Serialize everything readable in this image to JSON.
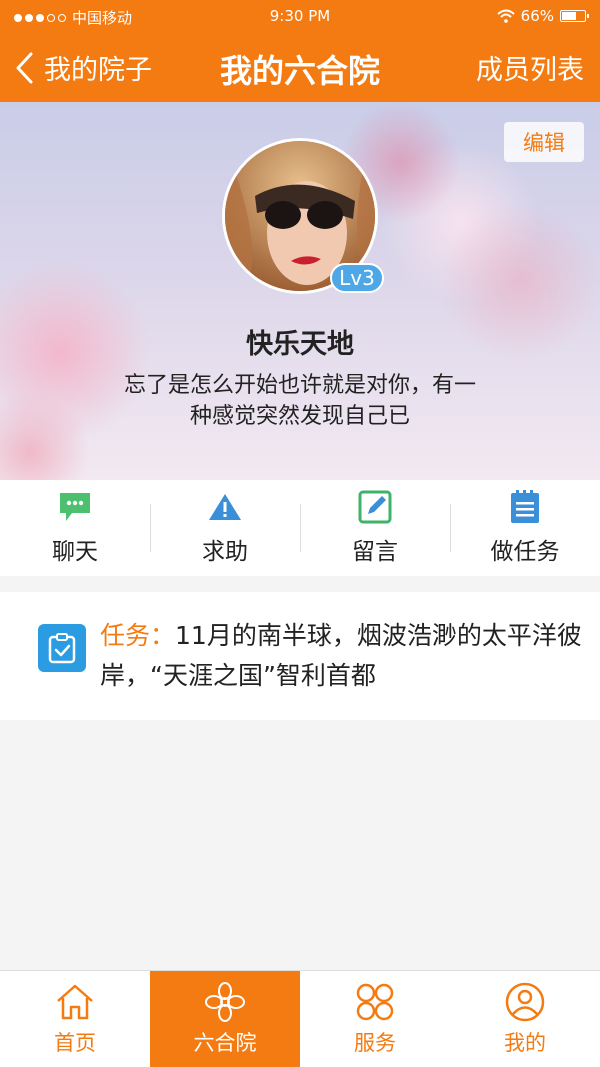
{
  "status_bar": {
    "carrier": "中国移动",
    "time": "9:30 PM",
    "battery": "66%"
  },
  "nav": {
    "back_label": "我的院子",
    "title": "我的六合院",
    "members_label": "成员列表"
  },
  "profile": {
    "edit_label": "编辑",
    "level": "Lv3",
    "name": "快乐天地",
    "bio_line1": "忘了是怎么开始也许就是对你，有一",
    "bio_line2": "种感觉突然发现自己已"
  },
  "actions": [
    {
      "label": "聊天",
      "icon": "chat-icon"
    },
    {
      "label": "求助",
      "icon": "warning-icon"
    },
    {
      "label": "留言",
      "icon": "edit-note-icon"
    },
    {
      "label": "做任务",
      "icon": "task-list-icon"
    }
  ],
  "task": {
    "prefix": "任务：",
    "text": "11月的南半球，烟波浩渺的太平洋彼岸，“天涯之国”智利首都"
  },
  "tabs": [
    {
      "label": "首页",
      "icon": "home-icon",
      "active": false
    },
    {
      "label": "六合院",
      "icon": "flower-icon",
      "active": true
    },
    {
      "label": "服务",
      "icon": "grid-icon",
      "active": false
    },
    {
      "label": "我的",
      "icon": "user-icon",
      "active": false
    }
  ],
  "colors": {
    "accent": "#f47b12",
    "badge": "#4ea8e8",
    "task_icon": "#2b9be2"
  }
}
